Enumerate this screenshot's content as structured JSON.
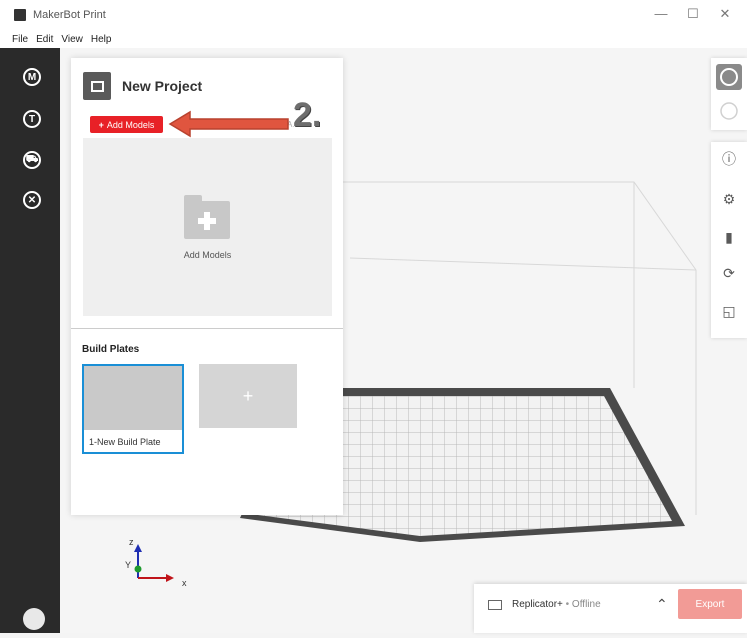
{
  "window": {
    "title": "MakerBot Print",
    "controls": [
      "—",
      "☐",
      "✕"
    ]
  },
  "menu": [
    "File",
    "Edit",
    "View",
    "Help"
  ],
  "leftnav": {
    "items": [
      "M",
      "T",
      "⛟",
      "✕"
    ]
  },
  "panel": {
    "title": "New Project",
    "add_button": "Add Models",
    "add_button_prefix": "+",
    "obscured_text": "A… e.",
    "dropzone_label": "Add Models",
    "build_plates_title": "Build Plates",
    "plates": [
      {
        "name": "1-New Build Plate"
      }
    ],
    "add_plate": "+"
  },
  "annotation": {
    "text": "2."
  },
  "rightbar": {
    "icons": [
      "ⓘ",
      "⚙",
      "▮",
      "⟳",
      "◱"
    ]
  },
  "axes": {
    "z": "z",
    "y": "Y",
    "x": "x"
  },
  "printer": {
    "name": "Replicator+",
    "sep": " • ",
    "status": "Offline",
    "chevron": "⌃"
  },
  "export_button": "Export",
  "colors": {
    "accent_red": "#e82127",
    "export_disabled": "#f29b96",
    "selected_blue": "#1a8fd6",
    "sidebar": "#2a2a2a"
  }
}
